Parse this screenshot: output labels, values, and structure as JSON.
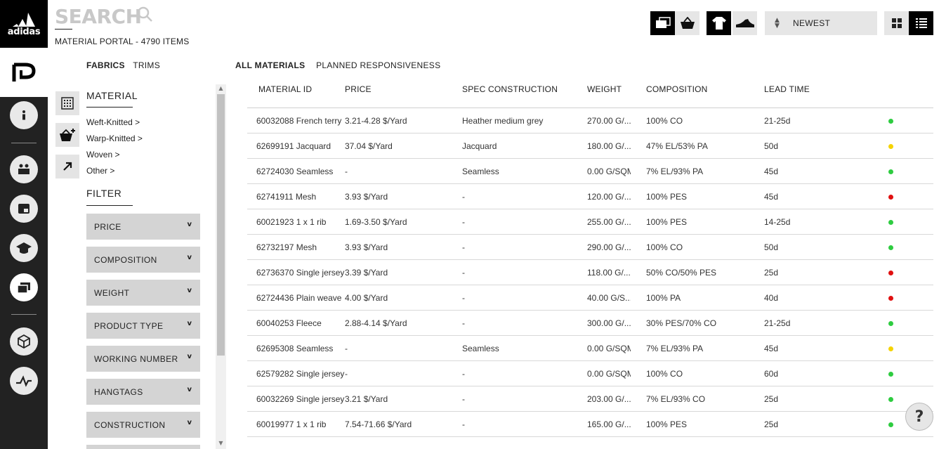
{
  "brand": {
    "logo_text": "adidas"
  },
  "header": {
    "search_title": "SEARCH",
    "subtitle": "MATERIAL PORTAL - 4790 ITEMS",
    "sort_value": "NEWEST"
  },
  "category_tabs": [
    {
      "label": "FABRICS",
      "active": true
    },
    {
      "label": "TRIMS",
      "active": false
    }
  ],
  "material_section": {
    "heading": "MATERIAL",
    "links": [
      "Weft-Knitted >",
      "Warp-Knitted >",
      "Woven >",
      "Other >"
    ]
  },
  "filter_section": {
    "heading": "FILTER",
    "filters": [
      "PRICE",
      "COMPOSITION",
      "WEIGHT",
      "PRODUCT TYPE",
      "WORKING NUMBER",
      "HANGTAGS",
      "CONSTRUCTION"
    ],
    "chevron": "v"
  },
  "view_tabs": [
    {
      "label": "ALL MATERIALS",
      "active": true
    },
    {
      "label": "PLANNED RESPONSIVENESS",
      "active": false
    }
  ],
  "table": {
    "headers": {
      "id": "MATERIAL ID",
      "price": "PRICE",
      "spec": "SPEC CONSTRUCTION",
      "weight": "WEIGHT",
      "composition": "COMPOSITION",
      "lead": "LEAD TIME"
    },
    "status_colors": {
      "green": "#2ecc40",
      "yellow": "#f5d300",
      "red": "#e01010"
    },
    "rows": [
      {
        "id": "60032088 French terry",
        "price": "3.21-4.28 $/Yard",
        "spec": "Heather medium grey",
        "weight": "270.00 G/...",
        "composition": "100% CO",
        "lead": "21-25d",
        "status": "green"
      },
      {
        "id": "62699191 Jacquard",
        "price": "37.04 $/Yard",
        "spec": "Jacquard",
        "weight": "180.00 G/...",
        "composition": "47% EL/53% PA",
        "lead": "50d",
        "status": "yellow"
      },
      {
        "id": "62724030 Seamless",
        "price": "-",
        "spec": "Seamless",
        "weight": "0.00 G/SQM",
        "composition": "7% EL/93% PA",
        "lead": "45d",
        "status": "green"
      },
      {
        "id": "62741911 Mesh",
        "price": "3.93 $/Yard",
        "spec": "-",
        "weight": "120.00 G/...",
        "composition": "100% PES",
        "lead": "45d",
        "status": "red"
      },
      {
        "id": "60021923 1 x 1 rib",
        "price": "1.69-3.50 $/Yard",
        "spec": "-",
        "weight": "255.00 G/...",
        "composition": "100% PES",
        "lead": "14-25d",
        "status": "green"
      },
      {
        "id": "62732197 Mesh",
        "price": "3.93 $/Yard",
        "spec": "-",
        "weight": "290.00 G/...",
        "composition": "100% CO",
        "lead": "50d",
        "status": "green"
      },
      {
        "id": "62736370 Single jersey",
        "price": "3.39 $/Yard",
        "spec": "-",
        "weight": "118.00 G/...",
        "composition": "50% CO/50% PES",
        "lead": "25d",
        "status": "red"
      },
      {
        "id": "62724436 Plain weave",
        "price": "4.00 $/Yard",
        "spec": "-",
        "weight": "40.00 G/S...",
        "composition": "100% PA",
        "lead": "40d",
        "status": "red"
      },
      {
        "id": "60040253 Fleece",
        "price": "2.88-4.14 $/Yard",
        "spec": "-",
        "weight": "300.00 G/...",
        "composition": "30% PES/70% CO",
        "lead": "21-25d",
        "status": "green"
      },
      {
        "id": "62695308 Seamless",
        "price": "-",
        "spec": "Seamless",
        "weight": "0.00 G/SQM",
        "composition": "7% EL/93% PA",
        "lead": "45d",
        "status": "yellow"
      },
      {
        "id": "62579282 Single jersey",
        "price": "-",
        "spec": "-",
        "weight": "0.00 G/SQM",
        "composition": "100% CO",
        "lead": "60d",
        "status": "green"
      },
      {
        "id": "60032269 Single jersey",
        "price": "3.21 $/Yard",
        "spec": "-",
        "weight": "203.00 G/...",
        "composition": "7% EL/93% CO",
        "lead": "25d",
        "status": "green"
      },
      {
        "id": "60019977 1 x 1 rib",
        "price": "7.54-71.66 $/Yard",
        "spec": "-",
        "weight": "165.00 G/...",
        "composition": "100% PES",
        "lead": "25d",
        "status": "green"
      }
    ]
  },
  "help": {
    "label": "?"
  }
}
